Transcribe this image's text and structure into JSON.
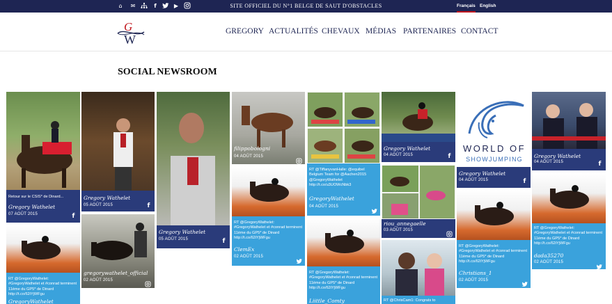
{
  "topbar": {
    "site_tagline": "SITE OFFICIEL DU N°1 BELGE DE SAUT D'OBSTACLES",
    "lang_fr": "Français",
    "lang_en": "English",
    "social_icons": [
      "home-icon",
      "mail-icon",
      "sitemap-icon",
      "facebook-icon",
      "twitter-icon",
      "youtube-icon",
      "instagram-icon"
    ]
  },
  "nav": {
    "items": [
      "GREGORY",
      "ACTUALITÉS",
      "CHEVAUX",
      "MÉDIAS",
      "PARTENAIRES",
      "CONTACT"
    ]
  },
  "page": {
    "title": "SOCIAL NEWSROOM"
  },
  "colors": {
    "navy": "#1e2553",
    "accent_red": "#c0161d",
    "facebook_card": "#2a3b7a",
    "twitter_card": "#3aa2dc"
  },
  "cards": [
    {
      "text": "Retour sur le CSIS* de Dinard...",
      "author": "Gregory Wathelet",
      "date": "07 AOÛT 2015",
      "network": "facebook"
    },
    {
      "text": "",
      "author": "Gregory Wathelet",
      "date": "05 AOÛT 2015",
      "network": "facebook"
    },
    {
      "text": "",
      "author": "Gregory Wathelet",
      "date": "05 AOÛT 2015",
      "network": "facebook"
    },
    {
      "text": "",
      "author": "filippobologni",
      "date": "04 AOÛT 2015",
      "network": "instagram"
    },
    {
      "text": "RT @TiffanyvanHalle: @equibel Belgium Team for @Aachen2015 @GregoryWathelet http://t.co/u3UOWcNbk3",
      "author": "GregoryWathelet",
      "date": "04 AOÛT 2015",
      "network": "twitter"
    },
    {
      "text": "",
      "author": "Gregory Wathelet",
      "date": "04 AOÛT 2015",
      "network": "facebook"
    },
    {
      "text": "",
      "author": "Gregory Wathelet",
      "date": "04 AOÛT 2015",
      "network": "facebook"
    },
    {
      "text": "",
      "author": "Gregory Wathelet",
      "date": "04 AOÛT 2015",
      "network": "facebook"
    },
    {
      "text": "RT @GregoryWathelet: #GregoryWathelet et #conrad terminent 11ème du GP5* de Dinard http://t.co/62iYjWFgu",
      "author": "GregoryWathelet",
      "date": "",
      "network": "twitter"
    },
    {
      "text": "",
      "author": "gregorywathelet_official",
      "date": "02 AOÛT 2015",
      "network": "instagram"
    },
    {
      "text": "RT @GregoryWathelet: #GregoryWathelet et #conrad terminent 11ème du GP5* de Dinard http://t.co/62iYjWFgu",
      "author": "ClemEx",
      "date": "02 AOÛT 2015",
      "network": "twitter"
    },
    {
      "text": "RT @GregoryWathelet: #GregoryWathelet et #conrad terminent 11ème du GP5* de Dinard http://t.co/62iYjWFgu",
      "author": "Liittle_Comty",
      "date": "",
      "network": "twitter"
    },
    {
      "text": "",
      "author": "riou_annegaelle",
      "date": "03 AOÛT 2015",
      "network": "instagram"
    },
    {
      "text": "RT @GregoryWathelet: #GregoryWathelet et #conrad terminent 11ème du GP5* de Dinard http://t.co/62iYjWFgu",
      "author": "Christians_1",
      "date": "02 AOÛT 2015",
      "network": "twitter"
    },
    {
      "text": "RT @GregoryWathelet: #GregoryWathelet et #conrad terminent 11ème du GP5* de Dinard http://t.co/62iYjWFgu",
      "author": "dada35270",
      "date": "02 AOÛT 2015",
      "network": "twitter"
    },
    {
      "text": "RT @ChrisCam1: Congrats to",
      "author": "",
      "date": "",
      "network": "twitter"
    }
  ],
  "world_of_showjumping": {
    "line1": "WORLD OF",
    "line2": "SHOWJUMPING"
  }
}
